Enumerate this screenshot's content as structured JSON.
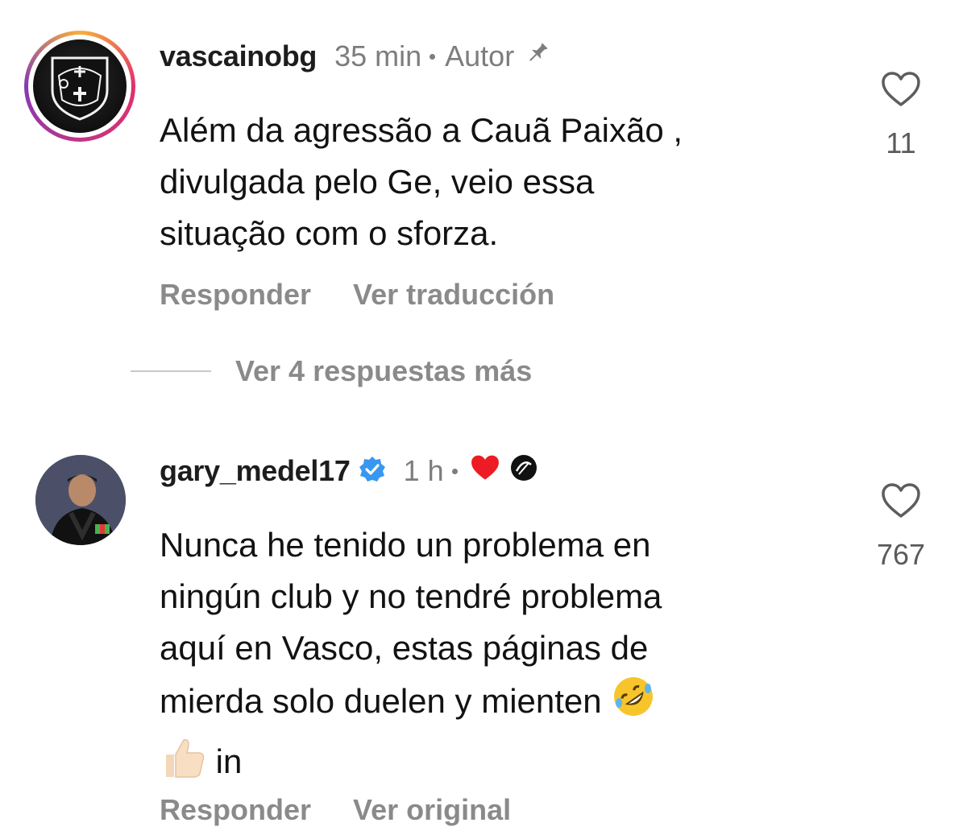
{
  "comments": [
    {
      "username": "vascainobg",
      "time": "35 min",
      "author_tag": "Autor",
      "icon": "pin-icon",
      "text_lines": [
        "Além da agressão a Cauã Paixão ,",
        "divulgada pelo Ge, veio essa",
        "situação com o sforza."
      ],
      "reply_label": "Responder",
      "translate_label": "Ver traducción",
      "likes": "11",
      "avatar": "vasco-crest-avatar"
    },
    {
      "username": "gary_medel17",
      "time": "1 h",
      "verified": true,
      "badges": [
        "red-heart-icon",
        "club-badge-icon"
      ],
      "text_lines": [
        "Nunca he tenido un problema en",
        "ningún club y no tendré problema",
        "aquí en Vasco, estas páginas de",
        "mierda solo duelen y mienten",
        "in"
      ],
      "emojis": [
        "rolling-laughing-emoji",
        "thumbs-up-emoji"
      ],
      "reply_label": "Responder",
      "original_label": "Ver original",
      "likes": "767",
      "avatar": "player-photo-avatar"
    }
  ],
  "more_replies_label": "Ver 4 respuestas más",
  "colors": {
    "text": "#121212",
    "muted": "#8a8a8a",
    "verified_blue": "#3897f0",
    "heart_red": "#ed1c24"
  }
}
